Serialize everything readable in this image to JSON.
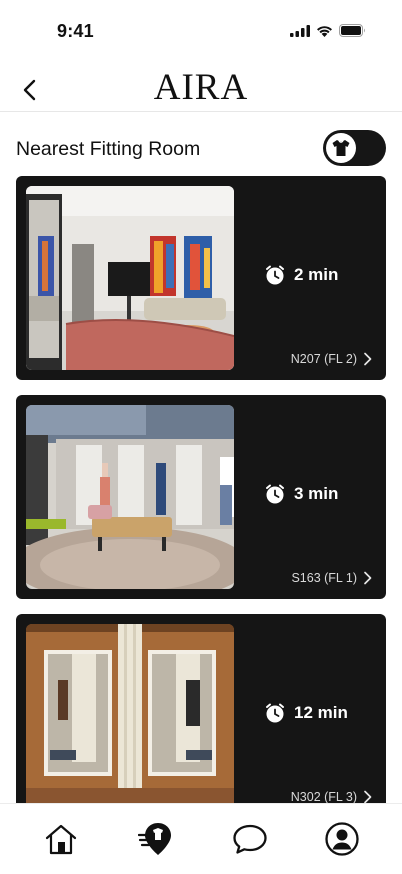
{
  "status_bar": {
    "time": "9:41",
    "icons": [
      "cellular-signal-icon",
      "wifi-icon",
      "battery-icon"
    ]
  },
  "header": {
    "title": "AIRA",
    "back_icon": "chevron-left-icon"
  },
  "section": {
    "title": "Nearest Fitting Room",
    "toggle_icon": "shirt-icon",
    "toggle_on": false
  },
  "rooms": [
    {
      "time": "2 min",
      "room": "N207 (FL 2)",
      "photo": "lounge fitting room with colorful paintings, TV and pink sofa"
    },
    {
      "time": "3 min",
      "room": "S163 (FL 1)",
      "photo": "fitting area with ottoman, mirrors and mannequins"
    },
    {
      "time": "12 min",
      "room": "N302 (FL 3)",
      "photo": "wooden fitting room booths with lit mirrors"
    }
  ],
  "bottom_nav": {
    "items": [
      {
        "name": "home",
        "icon": "home-icon",
        "active": false
      },
      {
        "name": "fitting-room-locator",
        "icon": "location-pin-speed-icon",
        "active": true
      },
      {
        "name": "chat",
        "icon": "chat-bubble-icon",
        "active": false
      },
      {
        "name": "profile",
        "icon": "user-circle-icon",
        "active": false
      }
    ]
  },
  "colors": {
    "card_bg": "#151515",
    "text_primary": "#111111",
    "text_on_card": "#ffffff"
  }
}
